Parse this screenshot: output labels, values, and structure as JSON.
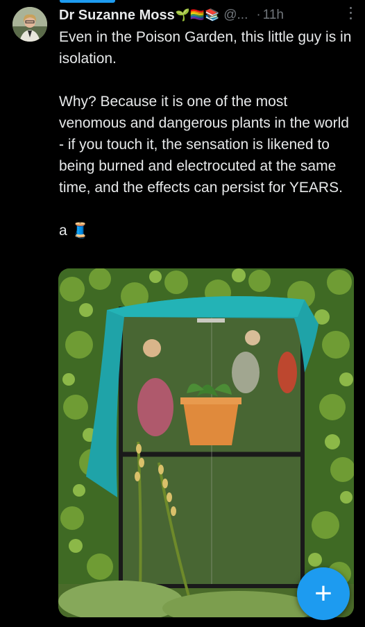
{
  "author": {
    "name": "Dr Suzanne Moss",
    "name_emojis": "🌱🏳️‍🌈📚",
    "handle": "@...",
    "separator": "·",
    "time": "11h"
  },
  "tweet": {
    "paragraphs": [
      "Even in the Poison Garden, this little guy is in isolation.",
      "Why? Because it is one of the most venomous and dangerous plants in the world - if you touch it, the sensation is likened to being burned and electrocuted at the same time, and the effects can persist for YEARS.",
      "a 🧵"
    ]
  },
  "fab": {
    "label": "+"
  },
  "colors": {
    "accent": "#1d9bf0",
    "text": "#e7e9ea",
    "muted": "#71767b",
    "background": "#000000",
    "cloth": "#1fa3a8",
    "pot": "#e08a3c"
  },
  "icons": [
    "avatar",
    "more-icon",
    "plus-icon"
  ]
}
